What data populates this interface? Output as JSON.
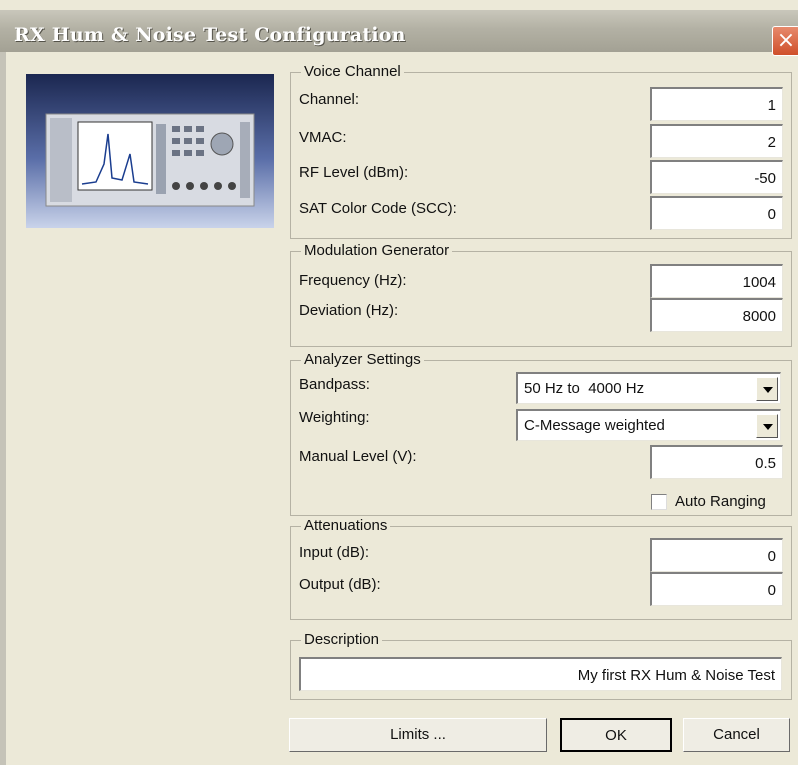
{
  "window": {
    "title": "RX Hum & Noise Test Configuration",
    "close_icon": "close-icon"
  },
  "voice_channel": {
    "legend": "Voice Channel",
    "fields": [
      {
        "label": "Channel:",
        "value": "1"
      },
      {
        "label": "VMAC:",
        "value": "2"
      },
      {
        "label": "RF Level (dBm):",
        "value": "-50"
      },
      {
        "label": "SAT Color Code (SCC):",
        "value": "0"
      }
    ]
  },
  "modulation_generator": {
    "legend": "Modulation Generator",
    "fields": [
      {
        "label": "Frequency (Hz):",
        "value": "1004"
      },
      {
        "label": "Deviation (Hz):",
        "value": "8000"
      }
    ]
  },
  "analyzer_settings": {
    "legend": "Analyzer Settings",
    "bandpass_label": "Bandpass:",
    "bandpass_value": "50 Hz to  4000 Hz",
    "weighting_label": "Weighting:",
    "weighting_value": "C-Message weighted",
    "manual_level_label": "Manual Level (V):",
    "manual_level_value": "0.5",
    "auto_ranging_label": "Auto Ranging",
    "auto_ranging_checked": false
  },
  "attenuations": {
    "legend": "Attenuations",
    "fields": [
      {
        "label": "Input (dB):",
        "value": "0"
      },
      {
        "label": "Output (dB):",
        "value": "0"
      }
    ]
  },
  "description": {
    "legend": "Description",
    "value": "My first RX Hum & Noise Test"
  },
  "buttons": {
    "limits": "Limits ...",
    "ok": "OK",
    "cancel": "Cancel"
  },
  "colors": {
    "dialog_bg": "#ece9d8",
    "titlebar": "#b3b1a4",
    "close_button": "#d9603a"
  }
}
